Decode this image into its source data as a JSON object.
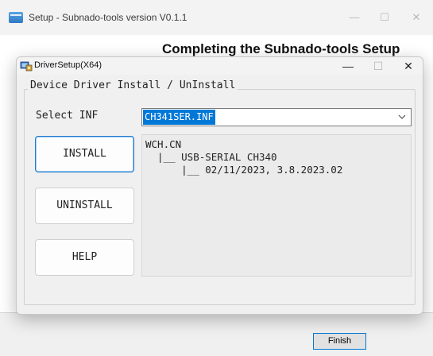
{
  "background_window": {
    "title": "Setup - Subnado-tools version V0.1.1",
    "heading": "Completing the Subnado-tools Setup",
    "controls": {
      "minimize": "—",
      "maximize": "☐",
      "close": "✕"
    },
    "finish_label": "Finish"
  },
  "dialog": {
    "title": "DriverSetup(X64)",
    "controls": {
      "minimize": "—",
      "maximize": "☐",
      "close": "✕"
    },
    "group_label": "Device Driver Install / UnInstall",
    "select_label": "Select INF",
    "selected_inf": "CH341SER.INF",
    "buttons": {
      "install": "INSTALL",
      "uninstall": "UNINSTALL",
      "help": "HELP"
    },
    "info_lines": [
      "WCH.CN",
      "  |__ USB-SERIAL CH340",
      "      |__ 02/11/2023, 3.8.2023.02"
    ]
  },
  "colors": {
    "accent": "#0078d7",
    "selection": "#0078d7"
  }
}
